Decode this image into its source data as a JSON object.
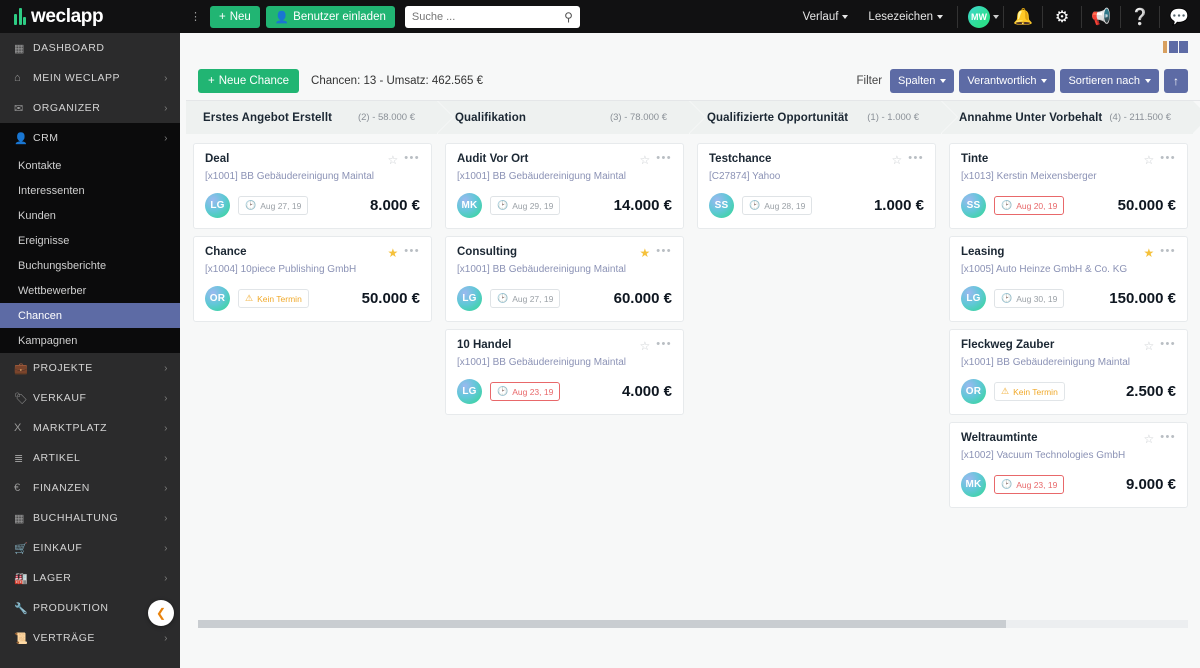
{
  "app": {
    "brand": "weclapp",
    "collapse_toggle": "⌄"
  },
  "topbar": {
    "new_button": "Neu",
    "invite_button": "Benutzer einladen",
    "search_placeholder": "Suche ...",
    "search_value": "",
    "menus": [
      {
        "label": "Verlauf",
        "name": "verlauf-menu"
      },
      {
        "label": "Lesezeichen",
        "name": "lesezeichen-menu"
      }
    ],
    "avatar_initials": "MW",
    "icons": [
      "bell-icon",
      "gear-icon",
      "megaphone-icon",
      "help-icon",
      "chat-icon"
    ]
  },
  "sidebar": {
    "items": [
      {
        "label": "DASHBOARD",
        "icon": "dashboard-icon",
        "chevron": false,
        "name": "sidebar-item-dashboard"
      },
      {
        "label": "MEIN WECLAPP",
        "icon": "home-icon",
        "chevron": true,
        "name": "sidebar-item-mein-weclapp"
      },
      {
        "label": "ORGANIZER",
        "icon": "mail-icon",
        "chevron": true,
        "name": "sidebar-item-organizer"
      },
      {
        "label": "CRM",
        "icon": "user-icon",
        "chevron": true,
        "name": "sidebar-item-crm",
        "open": true
      },
      {
        "label": "PROJEKTE",
        "icon": "briefcase-icon",
        "chevron": true,
        "name": "sidebar-item-projekte"
      },
      {
        "label": "VERKAUF",
        "icon": "tag-icon",
        "chevron": true,
        "name": "sidebar-item-verkauf"
      },
      {
        "label": "MARKTPLATZ",
        "icon": "marketplace-icon",
        "chevron": true,
        "name": "sidebar-item-marktplatz"
      },
      {
        "label": "ARTIKEL",
        "icon": "list-icon",
        "chevron": true,
        "name": "sidebar-item-artikel"
      },
      {
        "label": "FINANZEN",
        "icon": "euro-icon",
        "chevron": true,
        "name": "sidebar-item-finanzen"
      },
      {
        "label": "BUCHHALTUNG",
        "icon": "ledger-icon",
        "chevron": true,
        "name": "sidebar-item-buchhaltung"
      },
      {
        "label": "EINKAUF",
        "icon": "cart-icon",
        "chevron": true,
        "name": "sidebar-item-einkauf"
      },
      {
        "label": "LAGER",
        "icon": "warehouse-icon",
        "chevron": true,
        "name": "sidebar-item-lager"
      },
      {
        "label": "PRODUKTION",
        "icon": "wrench-icon",
        "chevron": true,
        "name": "sidebar-item-produktion"
      },
      {
        "label": "VERTRÄGE",
        "icon": "contract-icon",
        "chevron": true,
        "name": "sidebar-item-vertraege"
      }
    ],
    "crm_children": [
      {
        "label": "Kontakte",
        "active": false
      },
      {
        "label": "Interessenten",
        "active": false
      },
      {
        "label": "Kunden",
        "active": false
      },
      {
        "label": "Ereignisse",
        "active": false
      },
      {
        "label": "Buchungsberichte",
        "active": false
      },
      {
        "label": "Wettbewerber",
        "active": false
      },
      {
        "label": "Chancen",
        "active": true
      },
      {
        "label": "Kampagnen",
        "active": false
      }
    ]
  },
  "toolbar": {
    "new_opportunity": "Neue Chance",
    "summary": "Chancen: 13 - Umsatz: 462.565 €",
    "filter_label": "Filter",
    "columns_button": "Spalten",
    "responsible_button": "Verantwortlich",
    "sort_button": "Sortieren nach",
    "collapse_arrow": "↑",
    "view_icon": "kanban-view-icon"
  },
  "board": {
    "columns": [
      {
        "title": "Erstes Angebot Erstellt",
        "meta": "(2) - 58.000 €",
        "cards": [
          {
            "title": "Deal",
            "subtitle": "[x1001] BB Gebäudereinigung Maintal",
            "avatar": "LG",
            "badge": "Aug 27, 19",
            "badge_type": "clock",
            "amount": "8.000 €",
            "starred": false
          },
          {
            "title": "Chance",
            "subtitle": "[x1004] 10piece Publishing GmbH",
            "avatar": "OR",
            "badge": "Kein Termin",
            "badge_type": "warn",
            "amount": "50.000 €",
            "starred": true
          }
        ]
      },
      {
        "title": "Qualifikation",
        "meta": "(3) - 78.000 €",
        "cards": [
          {
            "title": "Audit Vor Ort",
            "subtitle": "[x1001] BB Gebäudereinigung Maintal",
            "avatar": "MK",
            "badge": "Aug 29, 19",
            "badge_type": "clock",
            "amount": "14.000 €",
            "starred": false
          },
          {
            "title": "Consulting",
            "subtitle": "[x1001] BB Gebäudereinigung Maintal",
            "avatar": "LG",
            "badge": "Aug 27, 19",
            "badge_type": "clock",
            "amount": "60.000 €",
            "starred": true
          },
          {
            "title": "10 Handel",
            "subtitle": "[x1001] BB Gebäudereinigung Maintal",
            "avatar": "LG",
            "badge": "Aug 23, 19",
            "badge_type": "overdue",
            "amount": "4.000 €",
            "starred": false
          }
        ]
      },
      {
        "title": "Qualifizierte Opportunität",
        "meta": "(1) - 1.000 €",
        "cards": [
          {
            "title": "Testchance",
            "subtitle": "[C27874] Yahoo",
            "avatar": "SS",
            "badge": "Aug 28, 19",
            "badge_type": "clock",
            "amount": "1.000 €",
            "starred": false
          }
        ]
      },
      {
        "title": "Annahme Unter Vorbehalt",
        "meta": "(4) - 211.500 €",
        "cards": [
          {
            "title": "Tinte",
            "subtitle": "[x1013] Kerstin Meixensberger",
            "avatar": "SS",
            "badge": "Aug 20, 19",
            "badge_type": "overdue",
            "amount": "50.000 €",
            "starred": false
          },
          {
            "title": "Leasing",
            "subtitle": "[x1005] Auto Heinze GmbH & Co. KG",
            "avatar": "LG",
            "badge": "Aug 30, 19",
            "badge_type": "clock",
            "amount": "150.000 €",
            "starred": true
          },
          {
            "title": "Fleckweg Zauber",
            "subtitle": "[x1001] BB Gebäudereinigung Maintal",
            "avatar": "OR",
            "badge": "Kein Termin",
            "badge_type": "warn",
            "amount": "2.500 €",
            "starred": false
          },
          {
            "title": "Weltraumtinte",
            "subtitle": "[x1002] Vacuum Technologies GmbH",
            "avatar": "MK",
            "badge": "Aug 23, 19",
            "badge_type": "overdue",
            "amount": "9.000 €",
            "starred": false
          }
        ]
      }
    ]
  },
  "colors": {
    "brand_green": "#21b573",
    "accent_blue": "#5d6ba5",
    "active_sidebar": "#5d6ba5",
    "star_on": "#f5c13b",
    "overdue_red": "#e8686a",
    "warn_orange": "#f0a92a"
  }
}
